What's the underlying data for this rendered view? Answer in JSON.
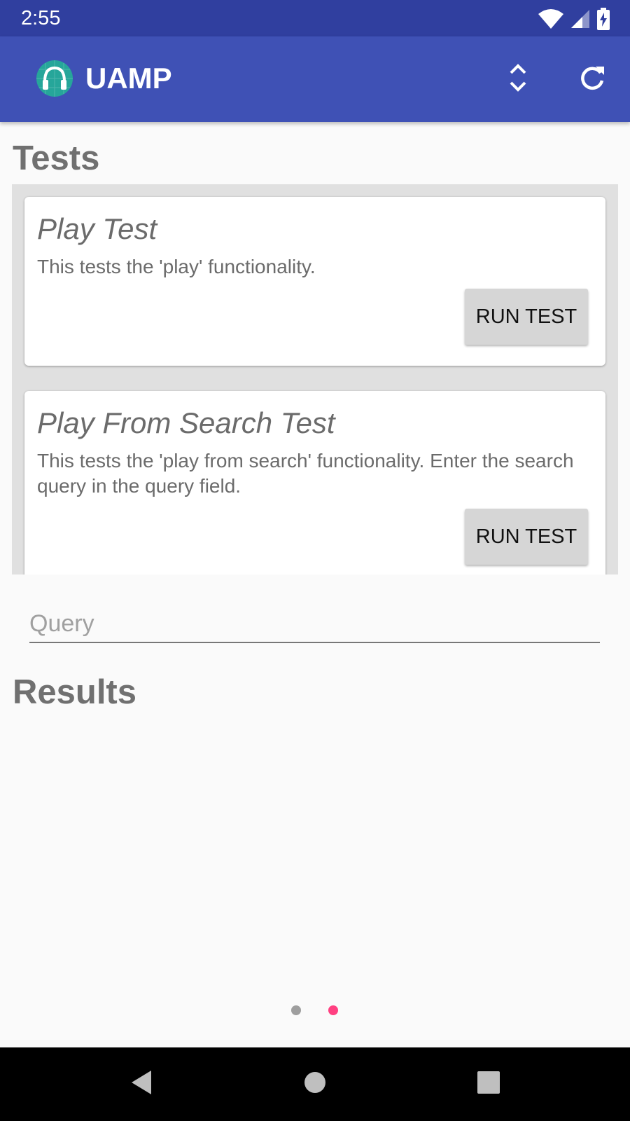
{
  "status_bar": {
    "time": "2:55",
    "icons": [
      "wifi-icon",
      "cell-signal-icon",
      "battery-charging-icon"
    ]
  },
  "app_bar": {
    "title": "UAMP",
    "logo_icon": "headphones-logo-icon",
    "actions": [
      "expand-collapse-icon",
      "refresh-icon"
    ]
  },
  "tests": {
    "heading": "Tests",
    "cards": [
      {
        "title": "Play Test",
        "description": "This tests the 'play' functionality.",
        "button": "RUN TEST"
      },
      {
        "title": "Play From Search Test",
        "description": "This tests the 'play from search' functionality. Enter the search query in the query field.",
        "button": "RUN TEST"
      }
    ]
  },
  "query": {
    "placeholder": "Query",
    "value": ""
  },
  "results": {
    "heading": "Results"
  },
  "pager": {
    "page_count": 2,
    "current_page": 2
  },
  "colors": {
    "status_bar": "#303f9f",
    "app_bar": "#3f51b5",
    "accent": "#ff4081",
    "logo": "#26a69a"
  },
  "nav_bar": {
    "icons": [
      "back-icon",
      "home-icon",
      "recents-icon"
    ]
  }
}
